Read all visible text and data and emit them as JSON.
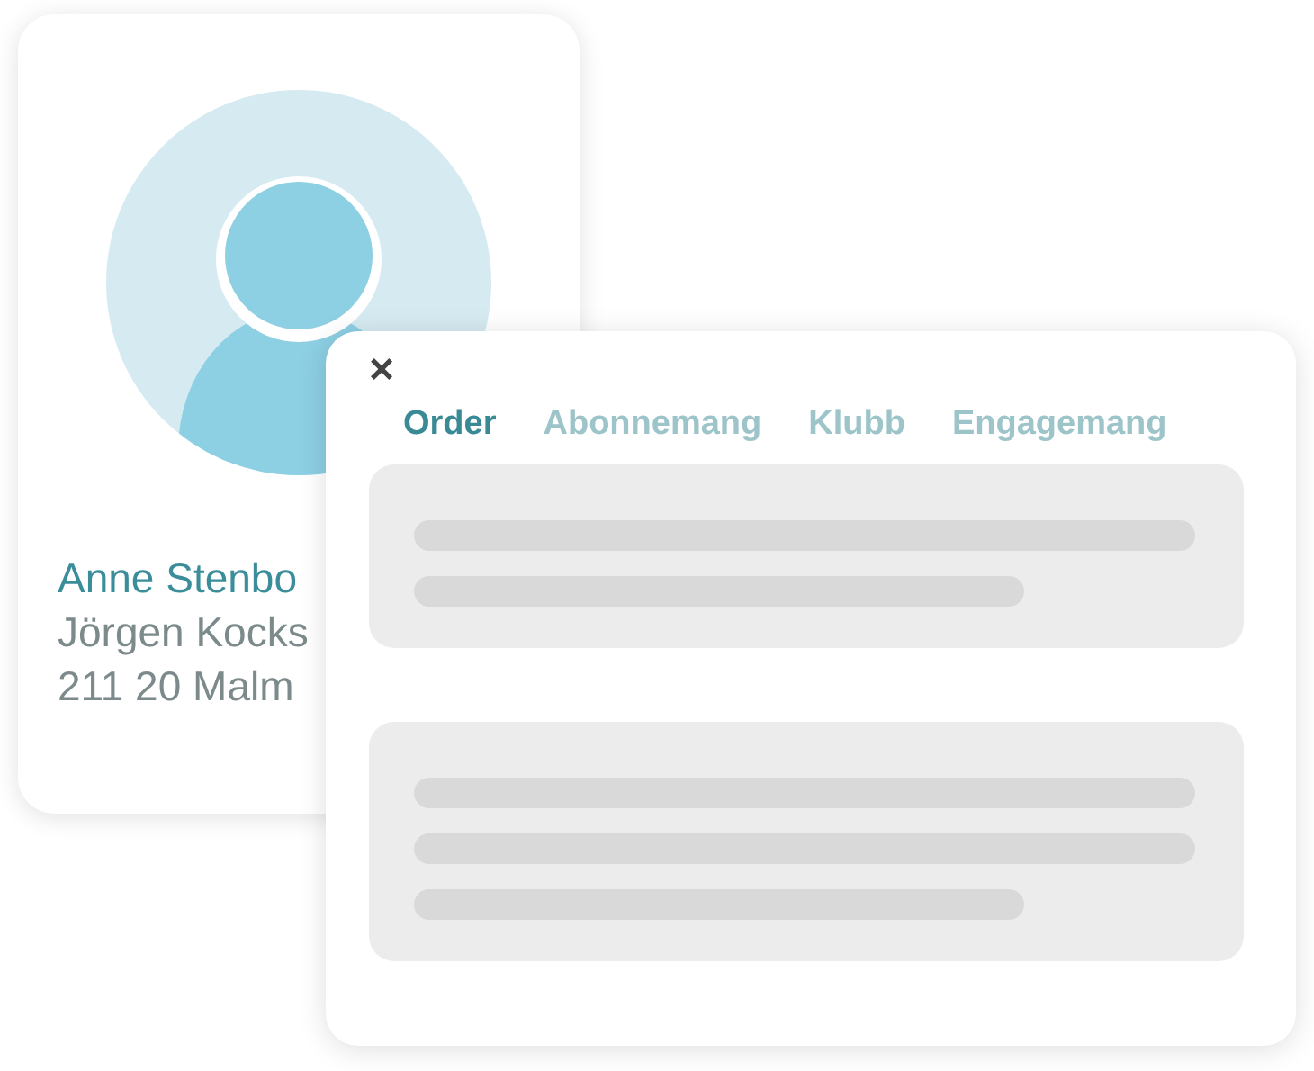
{
  "profile_card": {
    "name": "Anne Stenbo",
    "address_lines": [
      "Jörgen Kocks",
      "211 20 Malm"
    ]
  },
  "detail_card": {
    "close": "×",
    "tabs": [
      {
        "label": "Order",
        "selected": true
      },
      {
        "label": "Abonnemang",
        "selected": false
      },
      {
        "label": "Klubb",
        "selected": false
      },
      {
        "label": "Engagemang",
        "selected": false
      }
    ],
    "panels": [
      {
        "lines": [
          {
            "kind": "full"
          },
          {
            "kind": "short"
          }
        ]
      },
      {
        "lines": [
          {
            "kind": "full"
          },
          {
            "kind": "full"
          },
          {
            "kind": "short"
          }
        ]
      }
    ]
  }
}
